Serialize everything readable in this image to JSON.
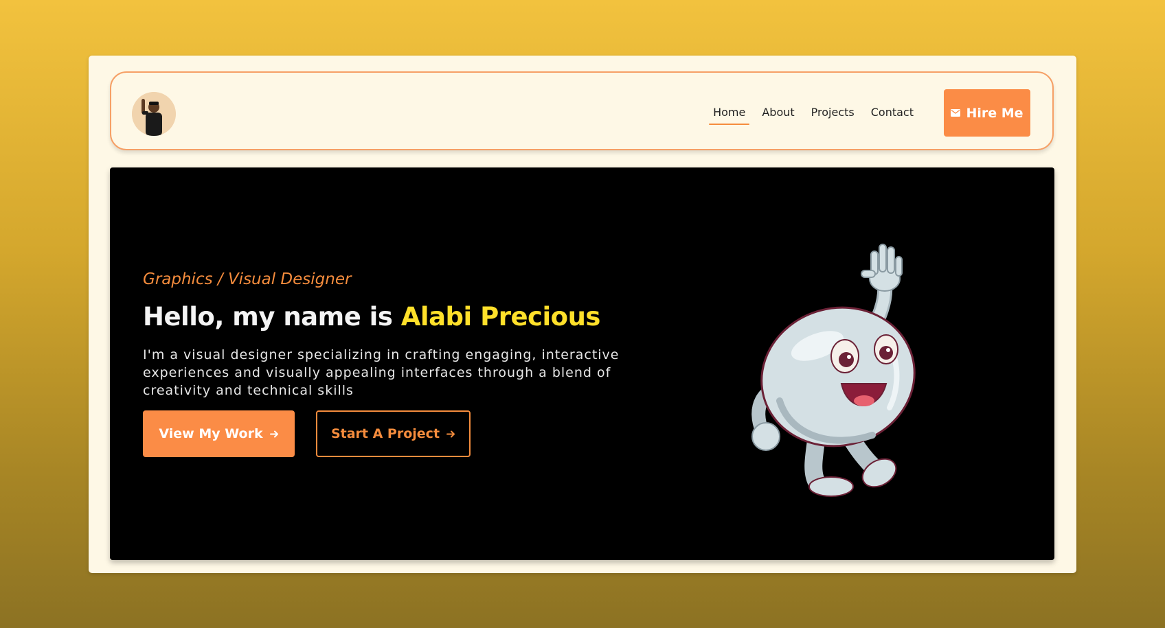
{
  "nav": {
    "links": [
      {
        "label": "Home",
        "active": true
      },
      {
        "label": "About",
        "active": false
      },
      {
        "label": "Projects",
        "active": false
      },
      {
        "label": "Contact",
        "active": false
      }
    ],
    "hire_label": "Hire Me"
  },
  "hero": {
    "subtitle": "Graphics / Visual Designer",
    "greeting": "Hello, my name is ",
    "name": "Alabi Precious",
    "description": "I'm a visual designer specializing in crafting engaging, interactive experiences and visually appealing interfaces through a blend of creativity and technical skills",
    "primary_button": "View My Work",
    "secondary_button": "Start A Project"
  },
  "colors": {
    "accent_orange": "#fb8c46",
    "name_yellow": "#ffe02a",
    "card_bg": "#fef8e6",
    "hero_bg": "#000000"
  }
}
